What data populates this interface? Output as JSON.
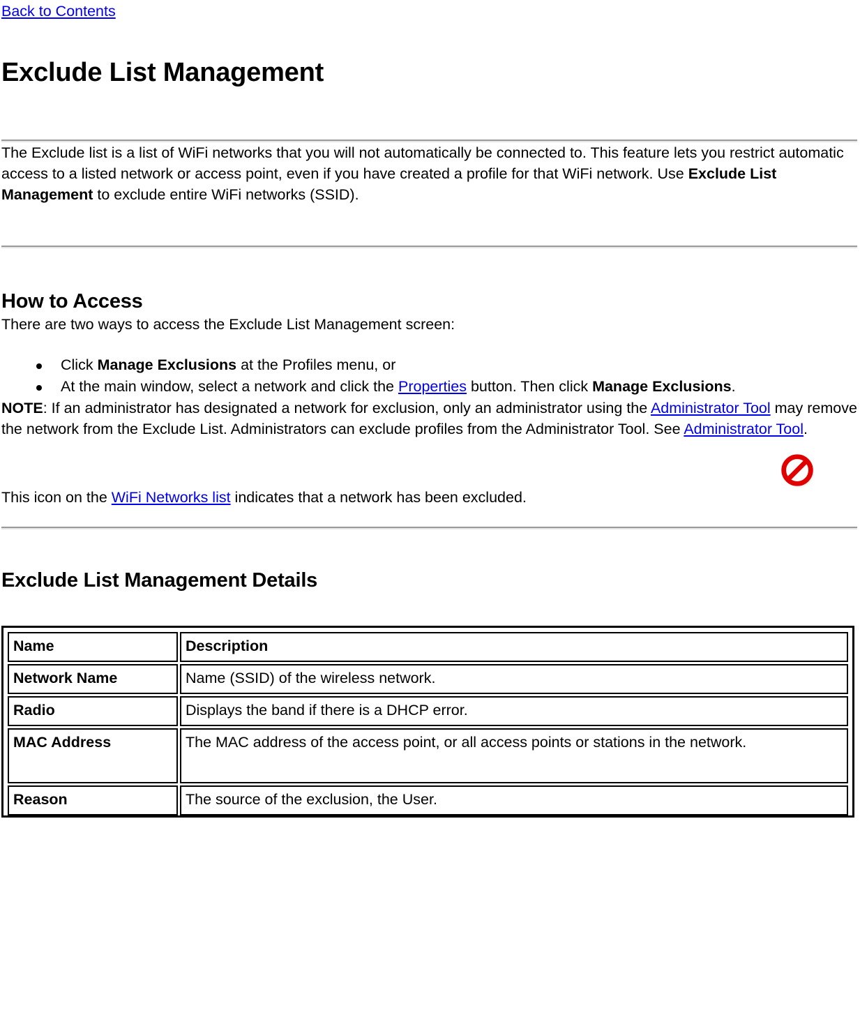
{
  "nav": {
    "back_link": "Back to Contents"
  },
  "header": {
    "title": "Exclude List Management"
  },
  "intro": {
    "part1": "The Exclude list is a list of WiFi networks that you will not automatically be connected to. This feature lets you restrict automatic access to a listed network or access point, even if you have created a profile for that WiFi network. Use ",
    "bold1": "Exclude List Management",
    "part2": " to exclude entire WiFi networks (SSID)."
  },
  "how_to_access": {
    "heading": "How to Access",
    "lead": "There are two ways to access the Exclude List Management screen:",
    "bullets": [
      {
        "pre": "Click ",
        "bold": "Manage Exclusions",
        "post": " at the Profiles menu, or"
      },
      {
        "pre": "At the main window, select a network and click the ",
        "link": "Properties",
        "mid": " button. Then click ",
        "bold": "Manage Exclusions",
        "post": "."
      }
    ]
  },
  "note": {
    "label": "NOTE",
    "part1": ": If an administrator has designated a network for exclusion, only an administrator using the ",
    "link1": "Administrator Tool",
    "part2": " may remove the network from the Exclude List. Administrators can exclude profiles from the Administrator Tool. See ",
    "link2": "Administrator Tool",
    "part3": "."
  },
  "icon_note": {
    "part1": "This icon on the ",
    "link": "WiFi Networks list",
    "part2": " indicates that a network has been excluded.",
    "icon_name": "excluded-network-icon",
    "icon_color": "#e00000"
  },
  "details": {
    "heading": "Exclude List Management Details",
    "columns": [
      "Name",
      "Description"
    ],
    "rows": [
      {
        "name": "Network Name",
        "description": "Name (SSID) of the wireless network."
      },
      {
        "name": "Radio",
        "description": "Displays the band if there is a DHCP error."
      },
      {
        "name": "MAC Address",
        "description": "The MAC address of the access point, or all access points or stations in the network."
      },
      {
        "name": "Reason",
        "description": "The source of the exclusion, the User."
      }
    ]
  }
}
